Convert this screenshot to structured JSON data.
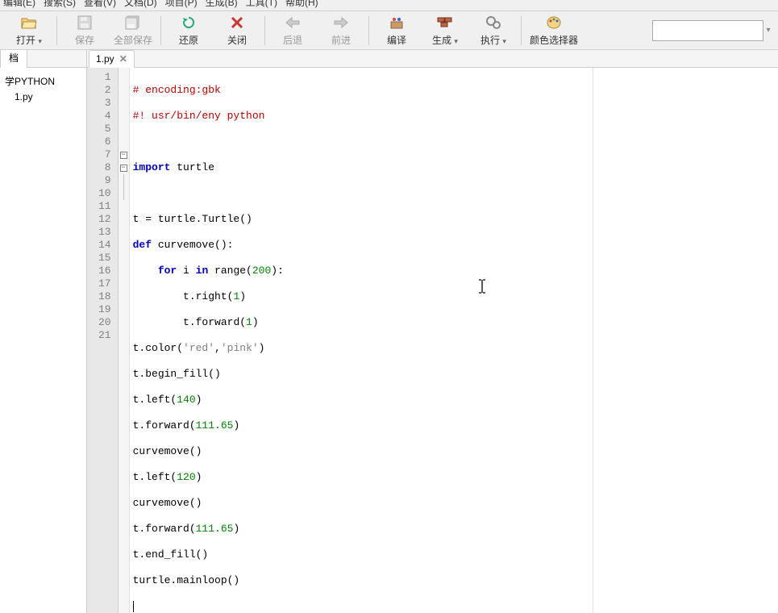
{
  "menubar": {
    "items": [
      "编辑(E)",
      "搜索(S)",
      "查看(V)",
      "文档(D)",
      "项目(P)",
      "生成(B)",
      "工具(T)",
      "帮助(H)"
    ]
  },
  "toolbar": {
    "open": {
      "label": "打开",
      "dropdown": true,
      "enabled": true
    },
    "save": {
      "label": "保存",
      "dropdown": false,
      "enabled": false
    },
    "saveall": {
      "label": "全部保存",
      "dropdown": false,
      "enabled": false
    },
    "revert": {
      "label": "还原",
      "dropdown": false,
      "enabled": true
    },
    "close": {
      "label": "关闭",
      "dropdown": false,
      "enabled": true
    },
    "back": {
      "label": "后退",
      "dropdown": false,
      "enabled": false
    },
    "forward": {
      "label": "前进",
      "dropdown": false,
      "enabled": false
    },
    "compile": {
      "label": "编译",
      "dropdown": false,
      "enabled": true
    },
    "build": {
      "label": "生成",
      "dropdown": true,
      "enabled": true
    },
    "run": {
      "label": "执行",
      "dropdown": true,
      "enabled": true
    },
    "colorpick": {
      "label": "颜色选择器",
      "dropdown": false,
      "enabled": true
    }
  },
  "sidebar": {
    "tab_label": "档",
    "tree": {
      "root": "学PYTHON",
      "children": [
        "1.py"
      ]
    }
  },
  "editor": {
    "tab": {
      "label": "1.py",
      "closeable": true
    },
    "line_numbers": [
      "1",
      "2",
      "3",
      "4",
      "5",
      "6",
      "7",
      "8",
      "9",
      "10",
      "11",
      "12",
      "13",
      "14",
      "15",
      "16",
      "17",
      "18",
      "19",
      "20",
      "21"
    ],
    "code": {
      "l1": {
        "comment": "# encoding:gbk"
      },
      "l2": {
        "comment": "#! usr/bin/eny python"
      },
      "l4": {
        "kw": "import",
        "rest": " turtle"
      },
      "l6": {
        "text_a": "t = turtle.Turtle()"
      },
      "l7": {
        "kw": "def",
        "name": " curvemove",
        "paren": "():"
      },
      "l8": {
        "indent": "    ",
        "kw1": "for",
        "mid": " i ",
        "kw2": "in",
        "mid2": " range(",
        "num": "200",
        "end": "):"
      },
      "l9": {
        "indent": "        ",
        "text": "t.right(",
        "num": "1",
        "end": ")"
      },
      "l10": {
        "indent": "        ",
        "text": "t.forward(",
        "num": "1",
        "end": ")"
      },
      "l11": {
        "text_a": "t.color(",
        "str1": "'red'",
        "comma": ",",
        "str2": "'pink'",
        "end": ")"
      },
      "l12": {
        "text_a": "t.begin_fill()"
      },
      "l13": {
        "text_a": "t.left(",
        "num": "140",
        "end": ")"
      },
      "l14": {
        "text_a": "t.forward(",
        "num": "111.65",
        "end": ")"
      },
      "l15": {
        "text_a": "curvemove()"
      },
      "l16": {
        "text_a": "t.left(",
        "num": "120",
        "end": ")"
      },
      "l17": {
        "text_a": "curvemove()"
      },
      "l18": {
        "text_a": "t.forward(",
        "num": "111.65",
        "end": ")"
      },
      "l19": {
        "text_a": "t.end_fill()"
      },
      "l20": {
        "text_a": "turtle.mainloop()"
      }
    }
  }
}
